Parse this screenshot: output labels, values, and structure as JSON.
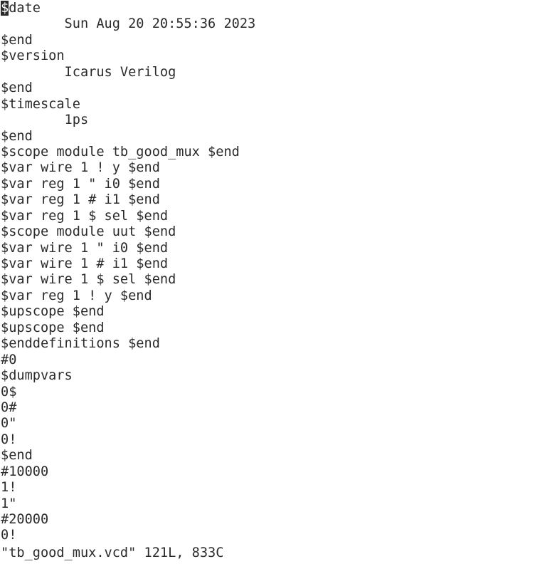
{
  "editor": {
    "cursor_char": "$",
    "first_line_rest": "date",
    "lines": [
      "        Sun Aug 20 20:55:36 2023",
      "$end",
      "$version",
      "        Icarus Verilog",
      "$end",
      "$timescale",
      "        1ps",
      "$end",
      "$scope module tb_good_mux $end",
      "$var wire 1 ! y $end",
      "$var reg 1 \" i0 $end",
      "$var reg 1 # i1 $end",
      "$var reg 1 $ sel $end",
      "$scope module uut $end",
      "$var wire 1 \" i0 $end",
      "$var wire 1 # i1 $end",
      "$var wire 1 $ sel $end",
      "$var reg 1 ! y $end",
      "$upscope $end",
      "$upscope $end",
      "$enddefinitions $end",
      "#0",
      "$dumpvars",
      "0$",
      "0#",
      "0\"",
      "0!",
      "$end",
      "#10000",
      "1!",
      "1\"",
      "#20000",
      "0!"
    ],
    "status": "\"tb_good_mux.vcd\" 121L, 833C"
  }
}
